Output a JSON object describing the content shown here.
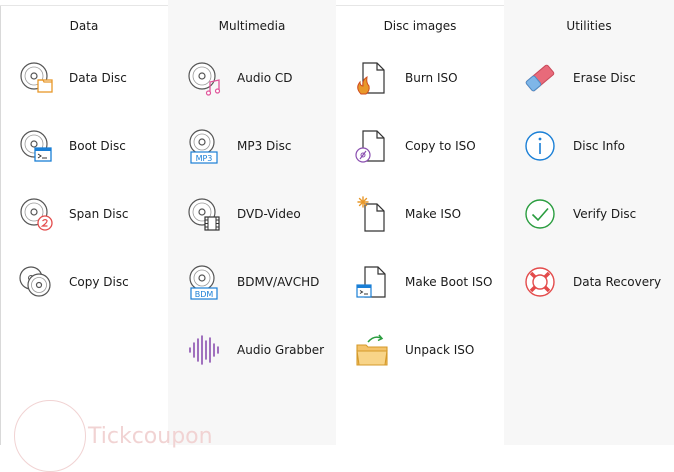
{
  "columns": [
    {
      "title": "Data",
      "items": [
        {
          "label": "Data Disc",
          "icon": "data-disc-icon"
        },
        {
          "label": "Boot Disc",
          "icon": "boot-disc-icon"
        },
        {
          "label": "Span Disc",
          "icon": "span-disc-icon"
        },
        {
          "label": "Copy Disc",
          "icon": "copy-disc-icon"
        }
      ]
    },
    {
      "title": "Multimedia",
      "items": [
        {
          "label": "Audio CD",
          "icon": "audio-cd-icon"
        },
        {
          "label": "MP3 Disc",
          "icon": "mp3-disc-icon",
          "badge": "MP3"
        },
        {
          "label": "DVD-Video",
          "icon": "dvd-video-icon"
        },
        {
          "label": "BDMV/AVCHD",
          "icon": "bdmv-disc-icon",
          "badge": "BDM"
        },
        {
          "label": "Audio Grabber",
          "icon": "audio-waveform-icon"
        }
      ]
    },
    {
      "title": "Disc images",
      "items": [
        {
          "label": "Burn ISO",
          "icon": "burn-iso-icon"
        },
        {
          "label": "Copy to ISO",
          "icon": "copy-to-iso-icon"
        },
        {
          "label": "Make ISO",
          "icon": "make-iso-icon"
        },
        {
          "label": "Make Boot ISO",
          "icon": "make-boot-iso-icon"
        },
        {
          "label": "Unpack ISO",
          "icon": "unpack-iso-icon"
        }
      ]
    },
    {
      "title": "Utilities",
      "items": [
        {
          "label": "Erase Disc",
          "icon": "eraser-icon"
        },
        {
          "label": "Disc Info",
          "icon": "info-icon"
        },
        {
          "label": "Verify Disc",
          "icon": "check-circle-icon"
        },
        {
          "label": "Data Recovery",
          "icon": "lifebuoy-icon"
        }
      ]
    }
  ],
  "watermark": {
    "text": "Tickcoupon"
  },
  "colors": {
    "accent_blue": "#1a7fd6",
    "orange": "#e8982a",
    "red": "#e34b4b",
    "green": "#2a9d3f",
    "pink": "#e0559a",
    "purple": "#8a4fb0"
  }
}
